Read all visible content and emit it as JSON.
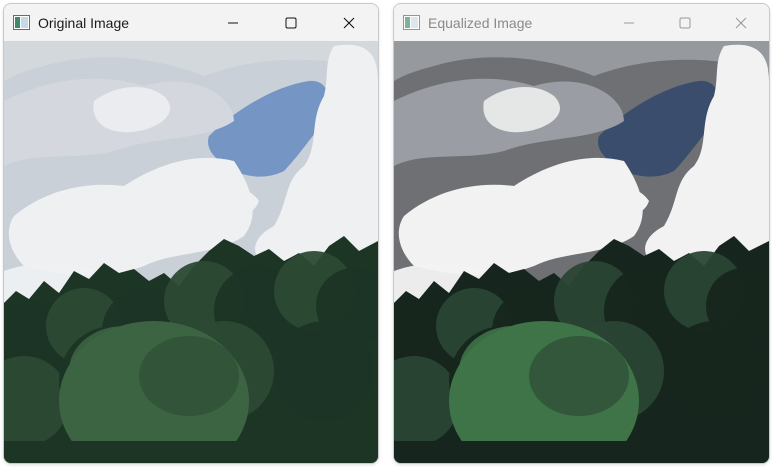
{
  "windows": [
    {
      "title": "Original Image",
      "state": "active",
      "icon": "image-window-icon",
      "controls": [
        "minimize-icon",
        "maximize-icon",
        "close-icon"
      ],
      "image": {
        "subject": "sky with clouds above a treeline",
        "colors": {
          "sky_top": "#c9d0d8",
          "sky_blue": "#7596c4",
          "cloud": "#eef0f2",
          "cloud_shade": "#d4d8de",
          "tree_dark": "#1c3525",
          "tree_mid": "#2c4a34",
          "tree_light": "#3c6443"
        }
      }
    },
    {
      "title": "Equalized Image",
      "state": "inactive",
      "icon": "image-window-icon",
      "controls": [
        "minimize-icon",
        "maximize-icon",
        "close-icon"
      ],
      "image": {
        "subject": "histogram-equalized sky with clouds above a treeline",
        "colors": {
          "sky_top": "#6e7074",
          "sky_blue": "#3a4d6c",
          "cloud": "#f2f2f2",
          "cloud_shade": "#9a9ea4",
          "tree_dark": "#16261e",
          "tree_mid": "#2a4434",
          "tree_light": "#3f7348"
        }
      }
    }
  ]
}
